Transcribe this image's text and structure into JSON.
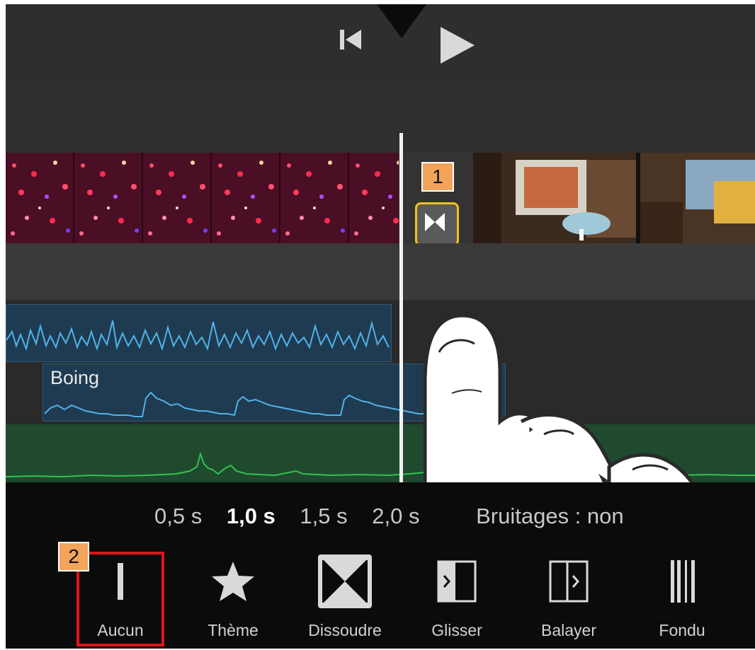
{
  "markers": {
    "one": "1",
    "two": "2"
  },
  "audio": {
    "clip_label": "Boing"
  },
  "durations": {
    "d1": "0,5 s",
    "d2": "1,0 s",
    "d3": "1,5 s",
    "d4": "2,0 s",
    "sound_effects": "Bruitages : non"
  },
  "transitions": [
    {
      "label": "Aucun",
      "icon": "none-transition-icon"
    },
    {
      "label": "Thème",
      "icon": "star-icon"
    },
    {
      "label": "Dissoudre",
      "icon": "dissolve-icon"
    },
    {
      "label": "Glisser",
      "icon": "slide-icon"
    },
    {
      "label": "Balayer",
      "icon": "wipe-icon"
    },
    {
      "label": "Fondu",
      "icon": "fade-icon"
    }
  ],
  "colors": {
    "highlight": "#e0141c",
    "badge": "#f2a45a",
    "transition_border": "#f2c21a",
    "audio_wave": "#4fb3e8",
    "music_wave": "#33c24f"
  }
}
